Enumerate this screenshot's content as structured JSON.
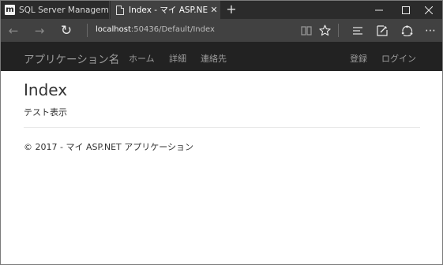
{
  "tabs": [
    {
      "title": "SQL Server Management St",
      "icon": "m",
      "active": false
    },
    {
      "title": "Index - マイ ASP.NET アプ",
      "icon": "page-icon",
      "active": true
    }
  ],
  "new_tab_symbol": "+",
  "window_controls": {
    "minimize": "—",
    "maximize": "☐",
    "close": "✕"
  },
  "address": {
    "host": "localhost",
    "path": ":50436/Default/Index"
  },
  "browser_icons": {
    "back": "←",
    "forward": "→",
    "refresh": "↻",
    "more": "⋯"
  },
  "site": {
    "brand": "アプリケーション名",
    "nav": [
      "ホーム",
      "詳細",
      "連絡先"
    ],
    "auth": [
      "登録",
      "ログイン"
    ]
  },
  "page": {
    "heading": "Index",
    "text": "テスト表示",
    "footer": "© 2017 - マイ ASP.NET アプリケーション"
  },
  "colors": {
    "chrome": "#2b2b2b",
    "active_tab": "#414141",
    "navbar": "#222222",
    "nav_text": "#9d9d9d"
  }
}
